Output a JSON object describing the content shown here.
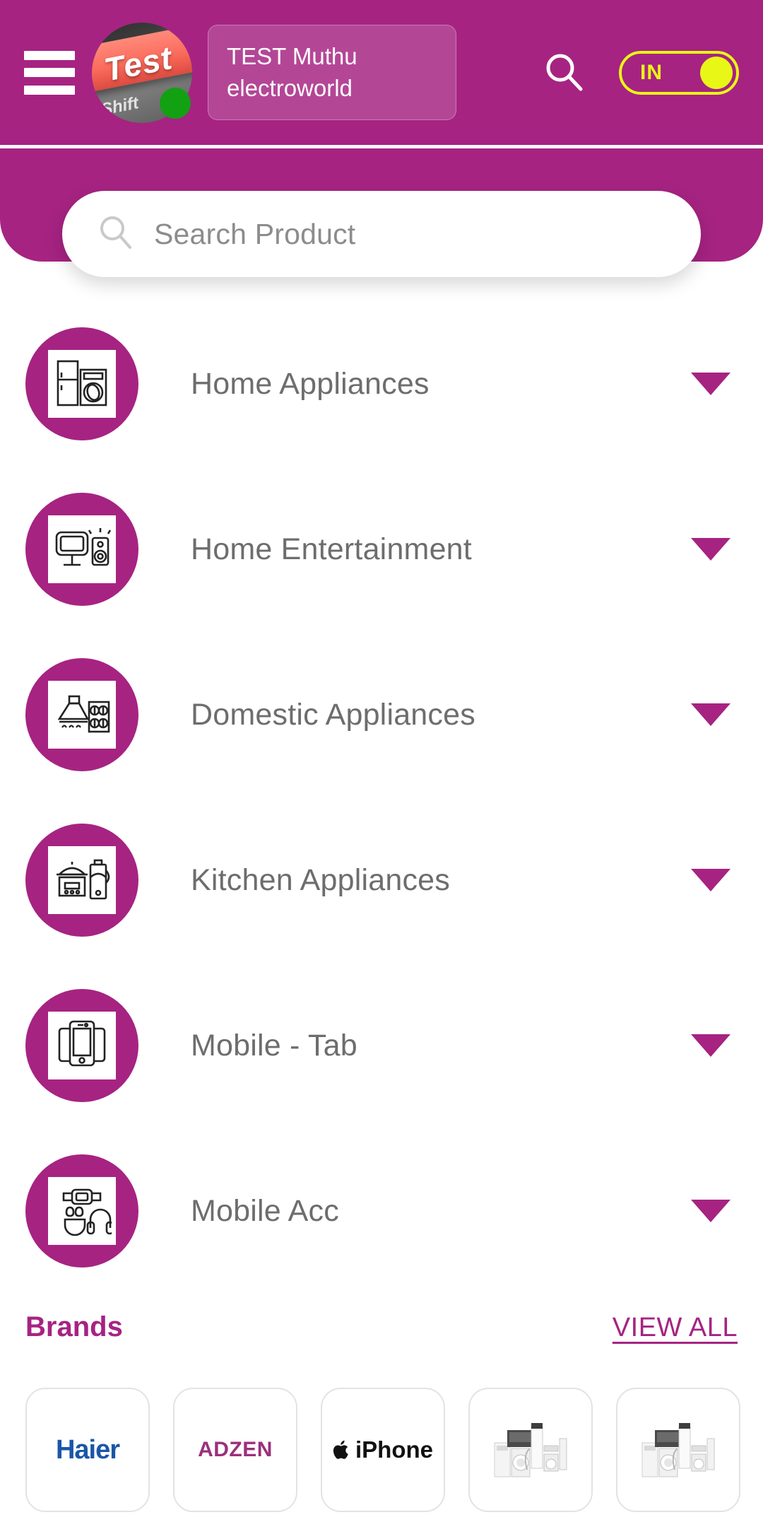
{
  "theme": {
    "brand_magenta": "#A62382",
    "accent_yellow": "#E8F716",
    "online_green": "#12A112",
    "text_gray": "#6D6D6D"
  },
  "header": {
    "menu_icon": "hamburger-menu-icon",
    "avatar": {
      "icon": "user-avatar-photo",
      "photo_text_primary": "Test",
      "photo_text_secondary": "Shift",
      "status": "online"
    },
    "user": {
      "name": "TEST Muthu",
      "store": "electroworld"
    },
    "search_icon": "search-icon",
    "language_toggle": {
      "label": "IN",
      "state": "on"
    }
  },
  "search": {
    "icon": "search-icon",
    "placeholder": "Search Product",
    "value": ""
  },
  "categories": [
    {
      "label": "Home Appliances",
      "icon": "fridge-washer-icon",
      "expand_icon": "chevron-down-icon"
    },
    {
      "label": "Home Entertainment",
      "icon": "tv-speaker-icon",
      "expand_icon": "chevron-down-icon"
    },
    {
      "label": "Domestic Appliances",
      "icon": "chimney-stove-icon",
      "expand_icon": "chevron-down-icon"
    },
    {
      "label": "Kitchen Appliances",
      "icon": "cooker-blender-icon",
      "expand_icon": "chevron-down-icon"
    },
    {
      "label": "Mobile - Tab",
      "icon": "phone-tablet-icon",
      "expand_icon": "chevron-down-icon"
    },
    {
      "label": "Mobile Acc",
      "icon": "watch-earbuds-headphones-icon",
      "expand_icon": "chevron-down-icon"
    }
  ],
  "brands_section": {
    "title": "Brands",
    "view_all": "VIEW ALL",
    "items": [
      {
        "name": "Haier",
        "type": "wordmark",
        "color": "#1A56A8"
      },
      {
        "name": "ADZEN",
        "type": "wordmark",
        "color": "#9C2F7D"
      },
      {
        "name": "iPhone",
        "type": "wordmark-with-apple-logo",
        "color": "#111111"
      },
      {
        "name": "",
        "type": "appliance-collage-image"
      },
      {
        "name": "",
        "type": "appliance-collage-image"
      }
    ]
  }
}
